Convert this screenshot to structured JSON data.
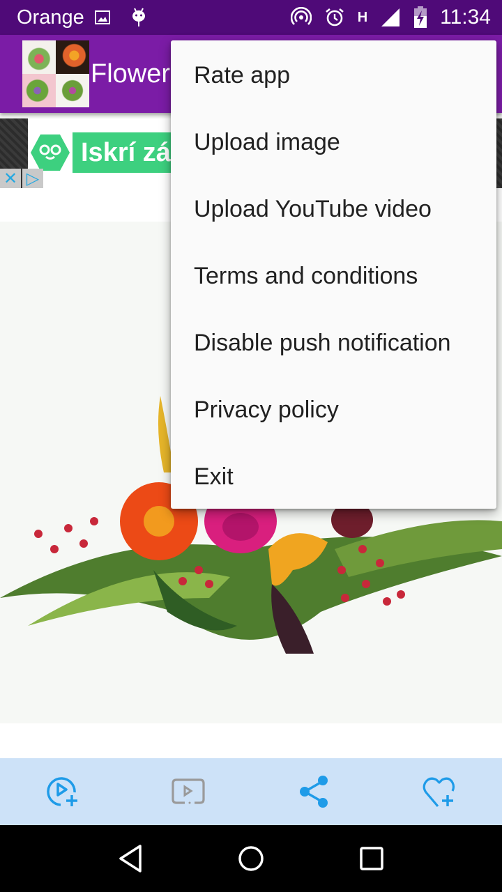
{
  "status_bar": {
    "carrier": "Orange",
    "time": "11:34",
    "network_type": "H",
    "icons_left": [
      "gallery-icon",
      "android-debug-icon"
    ],
    "icons_right": [
      "hotspot-icon",
      "alarm-icon",
      "network-h-icon",
      "signal-icon",
      "battery-charging-icon"
    ]
  },
  "app_bar": {
    "title": "Flowers"
  },
  "ad": {
    "text": "Iskrí zá",
    "close_label": "✕",
    "adchoices_label": "▷"
  },
  "menu": {
    "items": [
      {
        "label": "Rate app"
      },
      {
        "label": "Upload image"
      },
      {
        "label": "Upload YouTube video"
      },
      {
        "label": "Terms and conditions"
      },
      {
        "label": "Disable push notification"
      },
      {
        "label": "Privacy policy"
      },
      {
        "label": "Exit"
      }
    ]
  },
  "toolbar": {
    "buttons": [
      {
        "name": "add-video",
        "icon": "play-plus-icon",
        "color": "#1e9be8"
      },
      {
        "name": "youtube",
        "icon": "video-box-icon",
        "color": "#9a9a9a"
      },
      {
        "name": "share",
        "icon": "share-icon",
        "color": "#1e9be8"
      },
      {
        "name": "favorite",
        "icon": "heart-plus-icon",
        "color": "#1e9be8"
      }
    ]
  },
  "colors": {
    "status_bar": "#4f0a78",
    "app_bar": "#7b1ca6",
    "toolbar_bg": "#cde2f8",
    "accent_blue": "#1e9be8",
    "ad_green": "#3dd07f"
  },
  "navigation": {
    "buttons": [
      "back",
      "home",
      "recents"
    ]
  }
}
